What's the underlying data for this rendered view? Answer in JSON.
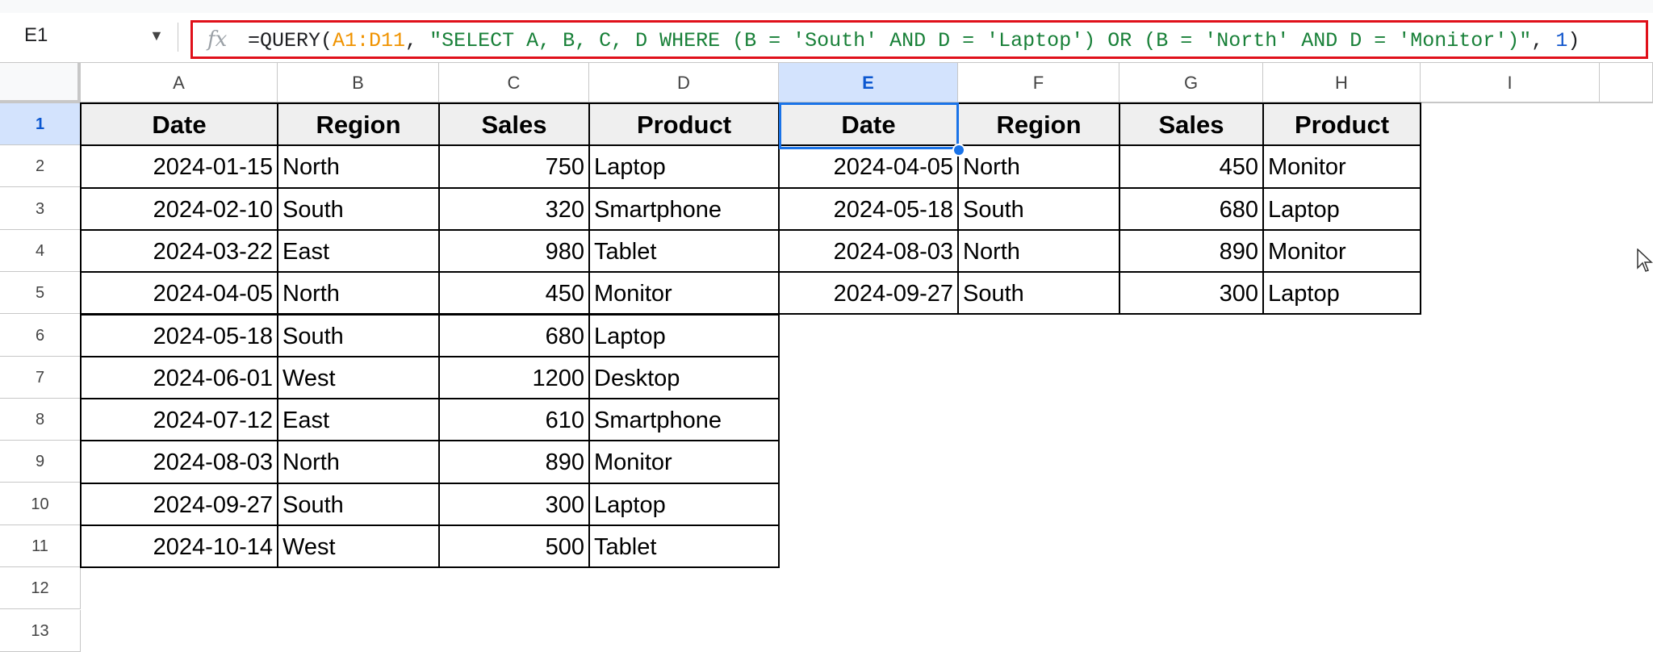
{
  "name_box": "E1",
  "formula": {
    "prefix": "=QUERY(",
    "range": "A1:D11",
    "comma1": ", ",
    "query": "\"SELECT A, B, C, D WHERE (B = 'South' AND D = 'Laptop') OR (B = 'North' AND D = 'Monitor')\"",
    "comma2": ", ",
    "headers": "1",
    "suffix": ")"
  },
  "columns": [
    "A",
    "B",
    "C",
    "D",
    "E",
    "F",
    "G",
    "H",
    "I"
  ],
  "rows": [
    "1",
    "2",
    "3",
    "4",
    "5",
    "6",
    "7",
    "8",
    "9",
    "10",
    "11",
    "12",
    "13"
  ],
  "source": {
    "headers": [
      "Date",
      "Region",
      "Sales",
      "Product"
    ],
    "data": [
      [
        "2024-01-15",
        "North",
        "750",
        "Laptop"
      ],
      [
        "2024-02-10",
        "South",
        "320",
        "Smartphone"
      ],
      [
        "2024-03-22",
        "East",
        "980",
        "Tablet"
      ],
      [
        "2024-04-05",
        "North",
        "450",
        "Monitor"
      ],
      [
        "2024-05-18",
        "South",
        "680",
        "Laptop"
      ],
      [
        "2024-06-01",
        "West",
        "1200",
        "Desktop"
      ],
      [
        "2024-07-12",
        "East",
        "610",
        "Smartphone"
      ],
      [
        "2024-08-03",
        "North",
        "890",
        "Monitor"
      ],
      [
        "2024-09-27",
        "South",
        "300",
        "Laptop"
      ],
      [
        "2024-10-14",
        "West",
        "500",
        "Tablet"
      ]
    ]
  },
  "result": {
    "headers": [
      "Date",
      "Region",
      "Sales",
      "Product"
    ],
    "data": [
      [
        "2024-04-05",
        "North",
        "450",
        "Monitor"
      ],
      [
        "2024-05-18",
        "South",
        "680",
        "Laptop"
      ],
      [
        "2024-08-03",
        "North",
        "890",
        "Monitor"
      ],
      [
        "2024-09-27",
        "South",
        "300",
        "Laptop"
      ]
    ]
  }
}
